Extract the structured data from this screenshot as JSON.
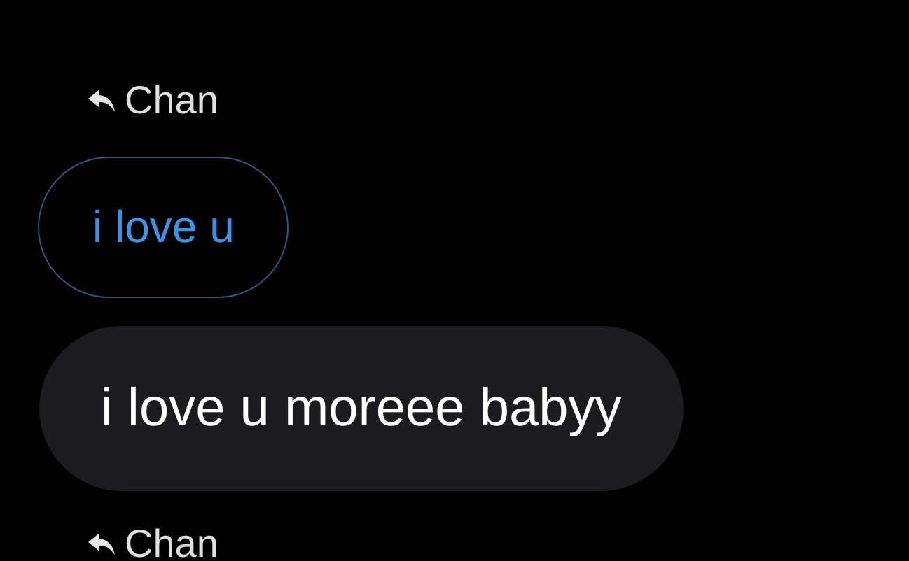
{
  "thread": [
    {
      "kind": "reply-label",
      "text": "Chan"
    },
    {
      "kind": "quoted",
      "text": "i love u"
    },
    {
      "kind": "message",
      "text": "i love u moreee babyy"
    },
    {
      "kind": "reply-label",
      "text": "Chan"
    }
  ]
}
